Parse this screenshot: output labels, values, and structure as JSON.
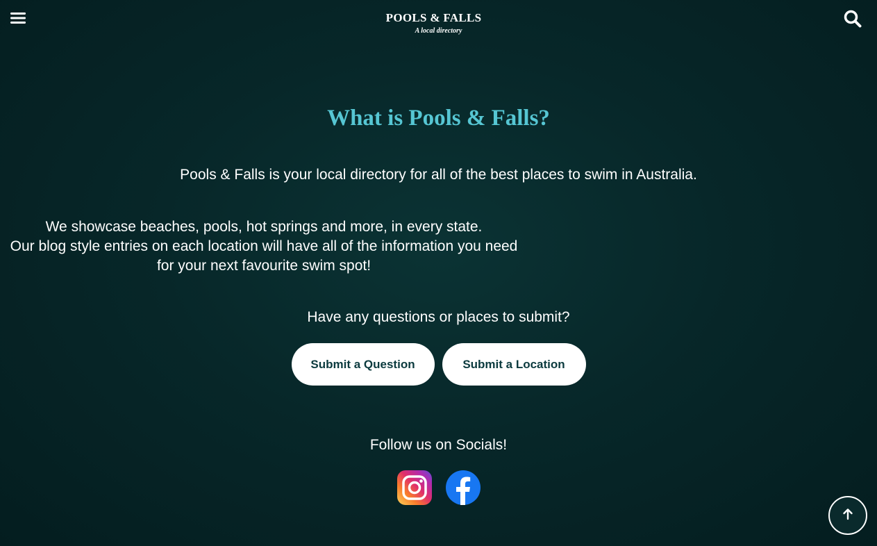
{
  "header": {
    "menu_icon": "hamburger-menu-icon",
    "search_icon": "search-icon",
    "logo_title": "POOLS & FALLS",
    "logo_tagline": "A local directory"
  },
  "main": {
    "heading": "What is Pools & Falls?",
    "intro": "Pools & Falls is your local directory for all of the best places to swim in Australia.",
    "showcase_line": "We showcase beaches, pools, hot springs and more, in every state.",
    "blog_line": "Our blog style entries on each location will have all of the information you need for your next favourite swim spot!",
    "question_prompt": "Have any questions or places to submit?",
    "buttons": {
      "submit_question": "Submit a Question",
      "submit_location": "Submit a Location"
    },
    "follow_label": "Follow us on Socials!",
    "socials": [
      {
        "name": "instagram",
        "icon": "instagram-icon"
      },
      {
        "name": "facebook",
        "icon": "facebook-icon"
      }
    ]
  },
  "back_to_top_icon": "arrow-up-icon",
  "colors": {
    "background": "#072729",
    "accent": "#56c6d3",
    "button_bg": "#ffffff",
    "button_text": "#0b3a3e",
    "facebook": "#1877f2"
  }
}
